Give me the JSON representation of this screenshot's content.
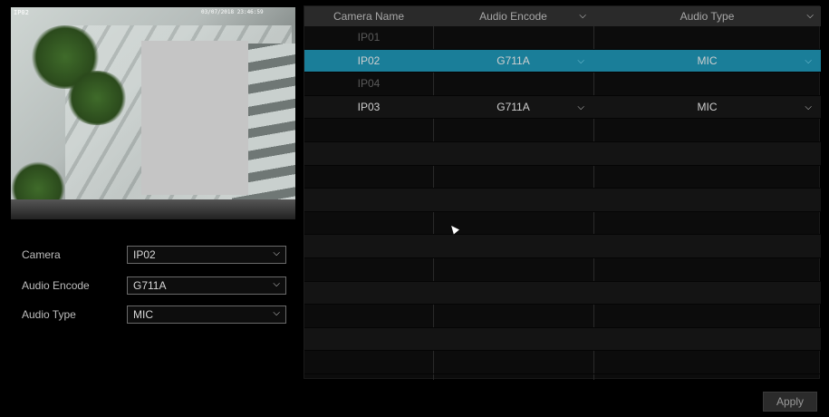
{
  "preview": {
    "camera_label": "IP02",
    "timestamp": "03/07/2018 23:46:59"
  },
  "form": {
    "camera": {
      "label": "Camera",
      "value": "IP02"
    },
    "audio_encode": {
      "label": "Audio Encode",
      "value": "G711A"
    },
    "audio_type": {
      "label": "Audio Type",
      "value": "MIC"
    }
  },
  "table": {
    "headers": [
      "Camera Name",
      "Audio Encode",
      "Audio Type"
    ],
    "rows": [
      {
        "name": "IP01",
        "encode": "",
        "type": "",
        "enabled": false,
        "selected": false
      },
      {
        "name": "IP02",
        "encode": "G711A",
        "type": "MIC",
        "enabled": true,
        "selected": true
      },
      {
        "name": "IP04",
        "encode": "",
        "type": "",
        "enabled": false,
        "selected": false
      },
      {
        "name": "IP03",
        "encode": "G711A",
        "type": "MIC",
        "enabled": true,
        "selected": false
      }
    ]
  },
  "icons": {
    "dropdown": "chevron-down-icon",
    "cursor": "mouse-pointer-icon"
  },
  "colors": {
    "selected_row": "#1a7e99",
    "header_bg": "#2a2a2a"
  },
  "apply_label": "Apply"
}
